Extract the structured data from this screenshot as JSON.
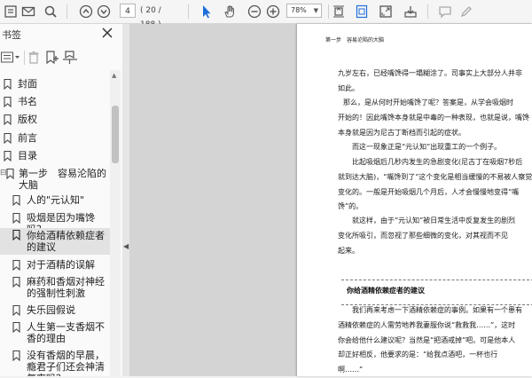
{
  "toolbar": {
    "page_current": "4",
    "page_total": "( 20 / 188 )",
    "zoom": "78%",
    "icons": [
      "print-icon",
      "email-icon",
      "search-icon",
      "prev-page-icon",
      "next-page-icon",
      "select-cursor-icon",
      "hand-tool-icon",
      "zoom-out-icon",
      "zoom-in-icon",
      "fit-page-icon",
      "actual-size-icon",
      "fullscreen-icon",
      "export-icon",
      "comment-icon",
      "pen-icon"
    ]
  },
  "sidebar": {
    "title": "书签",
    "bookmarks": [
      {
        "label": "封面"
      },
      {
        "label": "书名"
      },
      {
        "label": "版权"
      },
      {
        "label": "前言"
      },
      {
        "label": "目录"
      },
      {
        "label": "第一步　容易沦陷的大脑"
      },
      {
        "label": "人的\"元认知\""
      },
      {
        "label": "吸烟是因为嘴馋吗？"
      },
      {
        "label": "你给酒精依赖症者的建议"
      },
      {
        "label": "对于酒精的误解"
      },
      {
        "label": "麻药和香烟对神经的强制性刺激"
      },
      {
        "label": "失乐园假说"
      },
      {
        "label": "人生第一支香烟不香的理由"
      },
      {
        "label": "没有香烟的早晨，瘾君子们还会神清气爽吗？"
      }
    ]
  },
  "document": {
    "running_head": "第一步　容易沦陷的大脑",
    "paragraph1": [
      "九岁左右，已经嘴馋得一塌糊涂了。司事实上大部分人并非",
      "如此。"
    ],
    "paragraph2": [
      "那么，是从何时开始嘴馋了呢？答案是，从学会吸烟时",
      "开始的！因此嘴馋本身就是中毒的一种表现，也就是说，嘴馋",
      "本身就是因为尼古丁断档而引起的症状。"
    ],
    "paragraph3": [
      "而这一现象正是“元认知”出现重工的一个例子。"
    ],
    "paragraph4": [
      "比起吸烟后几秒内发生的急剧变化(尼古丁在吸烟7秒后",
      "就到达大脑)，“嘴馋到了”这个变化是相当缓慢的不易被人察觉的",
      "变化的。一般是开始吸烟几个月后，人才会慢慢地变得“嘴",
      "馋”的。"
    ],
    "paragraph5": [
      "就这样，由于“元认知”被日常生活中反复发生的剧烈",
      "变化所吸引，而忽视了那些细微的变化，对其视而不见",
      "起来。"
    ],
    "section_heading": "你给酒精依赖症者的建议",
    "paragraph6": [
      "我们再来考虑一下酒精依赖症的事例。如果有一个患有",
      "酒精依赖症的人需劳地养我妻服你说“救救我……”，这时",
      "你会给他什么建议呢？当然是“把酒戒掉”吧。可是他本人",
      "却正好相反，他要求的是：“给我点酒吧，一杯也行",
      "啊……”"
    ]
  }
}
